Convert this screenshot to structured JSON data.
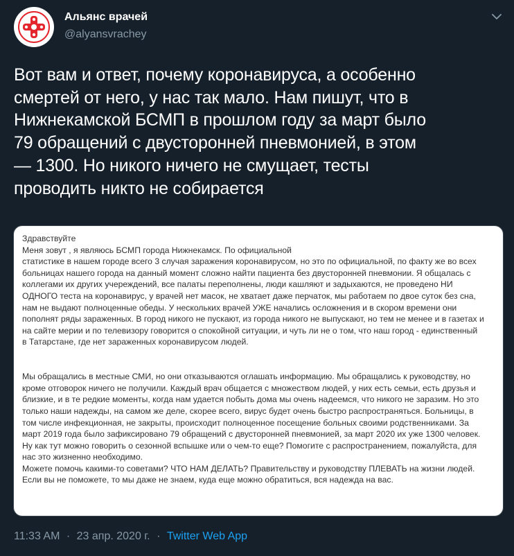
{
  "author": {
    "name": "Альянс врачей",
    "handle": "@alyansvrachey"
  },
  "tweet": {
    "text": "Вот вам и ответ, почему коронавируса, а особенно\nсмертей от него, у нас так мало. Нам пишут, что в\nНижнекамской БСМП в прошлом году за март было\n79 обращений с двусторонней пневмонией, в этом\n— 1300. Но никого ничего не смущает, тесты\nпроводить никто не собирается"
  },
  "media": {
    "paragraph1": "Здравствуйте\nМеня зовут                                           , я являюсь                                               БСМП города Нижнекамск. По официальной\nстатистике в нашем городе всего 3 случая заражения коронавирусом, но это по официальной, по факту же во всех\nбольницах нашего города на данный момент сложно найти пациента без двусторонней пневмонии. Я общалась с\nколлегами их других учереждений, все палаты переполнены, люди кашляют и задыхаются, не проведено НИ\nОДНОГО теста на коронавирус, у врачей нет масок, не хватает даже перчаток, мы работаем по двое суток без сна,\nнам не выдают полноценные обеды. У нескольких врачей УЖЕ начались осложнения и в скором времени они\nпополнят ряды зараженных. В город никого не пускают, из города никого не выпускают, но тем не менее и в газетах и\nна сайте мерии и по телевизору говорится о спокойной ситуации, и чуть ли не о том, что наш город - единственный\nв Татарстане, где нет зараженных коронавирусом людей.",
    "paragraph2": "Мы обращались в местные СМИ, но они отказываются оглашать информацию. Мы обращались к руководству, но\nкроме отговорок ничего не получили. Каждый врач общается с множеством людей, у них есть семьи, есть друзья и\nблизкие, и в те редкие моменты, когда нам удается побыть дома мы очень надеемся, что никого не заразим. Но это\nтолько наши надежды, на самом же деле, скорее всего, вирус будет очень быстро распространяться. Больницы, в\nтом числе инфекционная, не закрыты, происходит полноценное посещение больных своими родственниками. За\nмарт 2019 года было зафиксировано 79 обращений с двусторонней пневмонией, за март 2020 их уже 1300 человек.\nНу как тут можно говорить о сезонной вспышке или о чем-то еще? Помогите с распространением, пожалуйста, для\nнас это жизненно необходимо.\nМожете помочь какими-то советами? ЧТО НАМ ДЕЛАТЬ? Правительству и руководству ПЛЕВАТЬ на жизни людей.\nЕсли вы не поможете, то мы даже не знаем, куда еще можно обратиться, вся надежда на вас."
  },
  "meta": {
    "time": "11:33 AM",
    "separator": "·",
    "date": "23 апр. 2020 г.",
    "app": "Twitter Web App"
  },
  "icons": {
    "avatar": "medical-cross-logo",
    "menu": "chevron-down-icon"
  },
  "colors": {
    "background": "#15202b",
    "accent": "#1da1f2",
    "secondary_text": "#8899a6",
    "logo_red": "#e3262d"
  }
}
